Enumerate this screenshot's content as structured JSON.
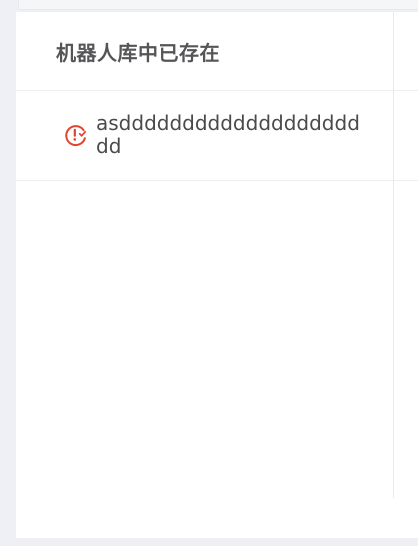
{
  "table": {
    "header": {
      "title": "机器人库中已存在"
    },
    "rows": [
      {
        "text": "asddddddddddddddddddddd",
        "status_icon": "error-clock-icon",
        "status_color": "#e0462f"
      }
    ]
  }
}
